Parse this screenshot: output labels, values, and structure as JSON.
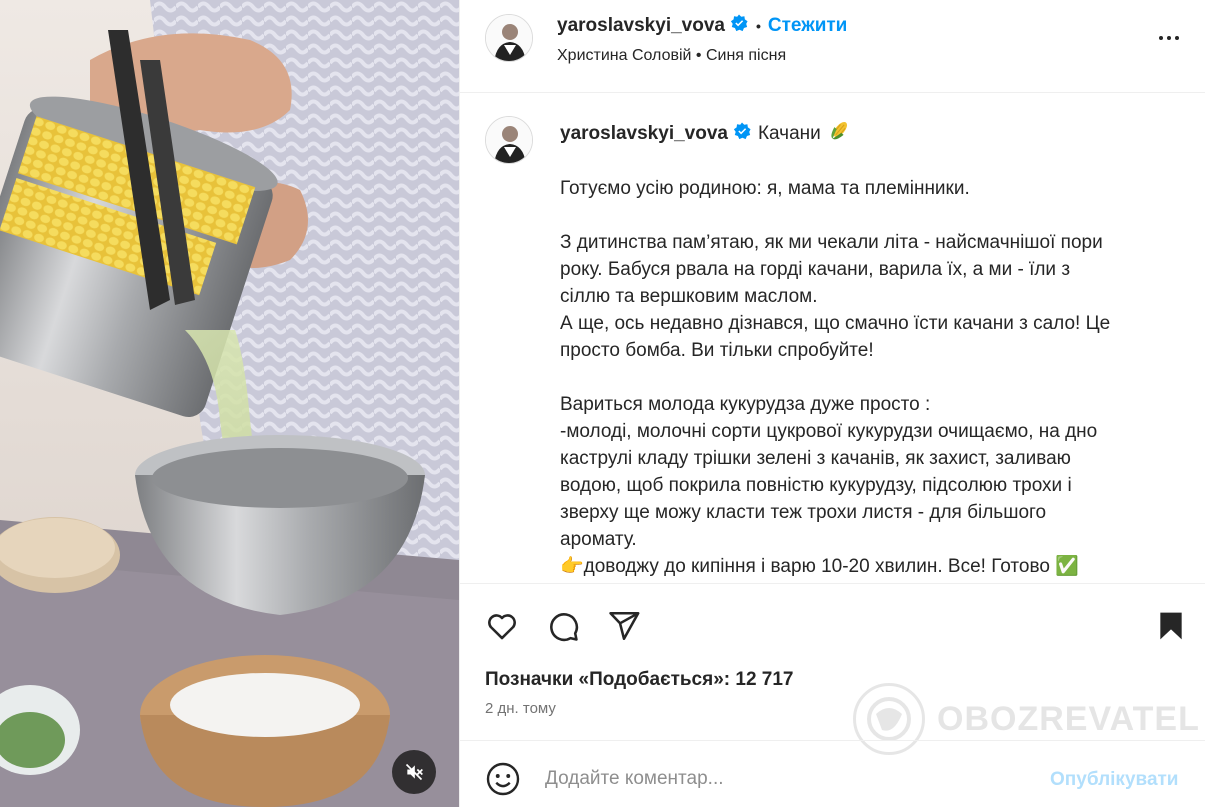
{
  "header": {
    "username": "yaroslavskyi_vova",
    "follow_label": "Стежити",
    "dot": "•",
    "music": "Христина Соловій • Синя пісня"
  },
  "caption": {
    "username": "yaroslavskyi_vova",
    "title": "Качани",
    "paragraphs": [
      "Готуємо усію родиною: я, мама та племінники.",
      "",
      "З дитинства пам’ятаю, як ми чекали літа - найсмачнішої пори",
      "року. Бабуся рвала на горді качани, варила їх, а ми - їли з",
      "сіллю та вершковим маслом.",
      "А ще, ось недавно дізнався, що смачно їсти качани з сало! Це",
      "просто бомба. Ви тільки спробуйте!",
      "",
      "Вариться молода кукурудза дуже просто :",
      "-молоді, молочні сорти цукрової кукурудзи очищаємо, на дно",
      "каструлі кладу трішки зелені з качанів, як захист, заливаю",
      "водою, щоб покрила повністю кукурудзу, підсолюю трохи і",
      "зверху ще можу класти теж трохи листя - для більшого",
      "аромату.",
      "👉доводжу до кипіння і варю 10-20 хвилин. Все! Готово ✅"
    ]
  },
  "actions": {
    "likes": "Позначки «Подобається»: 12 717",
    "time": "2 дн. тому"
  },
  "watermark": "OBOZREVATEL",
  "comment": {
    "placeholder": "Додайте коментар...",
    "publish_label": "Опублікувати"
  },
  "icons": {
    "verified": "verified-badge-icon",
    "more": "more-options-icon",
    "like": "heart-icon",
    "comment": "comment-icon",
    "share": "send-icon",
    "save": "bookmark-icon",
    "emoji": "emoji-icon",
    "mute": "sound-off-icon",
    "corn": "corn-emoji-icon"
  },
  "colors": {
    "accent": "#0095f6",
    "verified": "#0095f6",
    "publish_disabled": "#b2dffc",
    "text": "#262626",
    "muted": "#737373"
  }
}
